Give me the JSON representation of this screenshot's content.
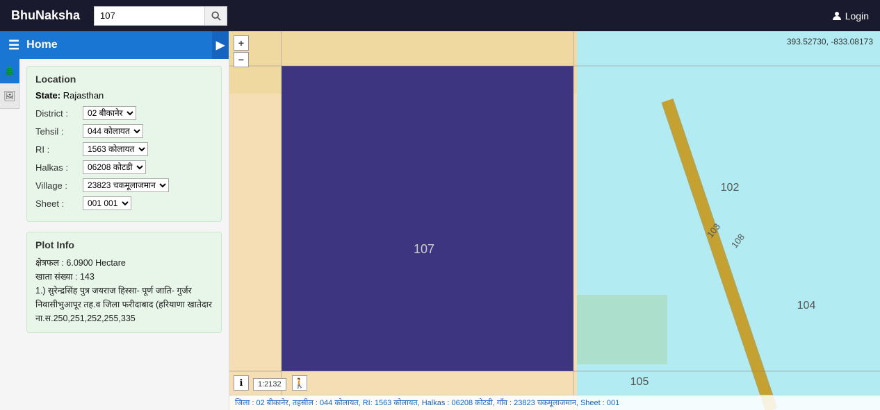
{
  "navbar": {
    "brand": "BhuNaksha",
    "search_value": "107",
    "search_placeholder": "Search",
    "login_label": "Login"
  },
  "sidebar": {
    "home_label": "Home",
    "icons": [
      {
        "name": "tree-icon",
        "symbol": "🌲"
      },
      {
        "name": "image-icon",
        "symbol": "🖼"
      }
    ],
    "location": {
      "title": "Location",
      "state_label": "State:",
      "state_value": "Rajasthan",
      "fields": [
        {
          "label": "District :",
          "selected": "02 बीकानेर",
          "options": [
            "02 बीकानेर"
          ]
        },
        {
          "label": "Tehsil :",
          "selected": "044 कोलायत",
          "options": [
            "044 कोलायत"
          ]
        },
        {
          "label": "RI :",
          "selected": "1563 कोलायत",
          "options": [
            "1563 कोलायत"
          ]
        },
        {
          "label": "Halkas :",
          "selected": "06208 कोटडी",
          "options": [
            "06208 कोटडी"
          ]
        },
        {
          "label": "Village :",
          "selected": "23823 चकमूलाजमान",
          "options": [
            "23823 चकमूलाजमान"
          ]
        },
        {
          "label": "Sheet :",
          "selected": "001 001",
          "options": [
            "001 001"
          ]
        }
      ]
    },
    "plot_info": {
      "title": "Plot Info",
      "area_label": "क्षेत्रफल : 6.0900 Hectare",
      "account_label": "खाता संख्या : 143",
      "owner_text": "1.) सुरेन्द्रसिंह पुत्र जयराज हिस्सा- पूर्ण जाति- गुर्जर निवासीभुआपूर तह.व जिला फरीदाबाद (हरियाणा खातेदार",
      "survey_label": "ना.स.250,251,252,255,335"
    }
  },
  "map": {
    "coords": "393.52730, -833.08173",
    "plot_number": "107",
    "nearby_plots": [
      "102",
      "104",
      "105"
    ],
    "road_label": "103",
    "zoom_in": "+",
    "zoom_out": "−",
    "scale": "1:2132",
    "status_bar": "जिला : 02 बीकानेर, तहसील : 044 कोलायत, RI: 1563 कोलायत, Halkas : 06208 कोटडी, गाँव : 23823 चकमूलाजमान, Sheet : 001"
  }
}
